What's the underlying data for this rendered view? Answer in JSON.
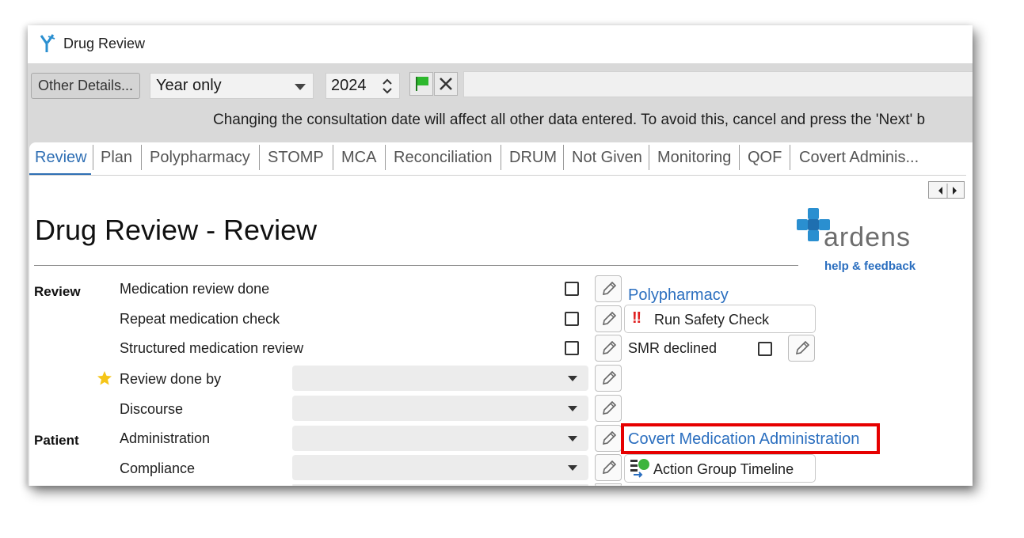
{
  "window": {
    "title": "Drug Review"
  },
  "toolbar": {
    "other_details_label": "Other Details...",
    "date_mode_value": "Year only",
    "year_value": "2024",
    "warning_text": "Changing the consultation date will affect all other data entered. To avoid this, cancel and press the 'Next' b"
  },
  "tabs": [
    {
      "label": "Review"
    },
    {
      "label": "Plan"
    },
    {
      "label": "Polypharmacy"
    },
    {
      "label": "STOMP"
    },
    {
      "label": "MCA"
    },
    {
      "label": "Reconciliation"
    },
    {
      "label": "DRUM"
    },
    {
      "label": "Not Given"
    },
    {
      "label": "Monitoring"
    },
    {
      "label": "QOF"
    },
    {
      "label": "Covert Adminis..."
    }
  ],
  "page": {
    "title": "Drug Review - Review"
  },
  "branding": {
    "name": "ardens",
    "help_link": "help & feedback",
    "brand_color": "#2a8fd0"
  },
  "sections": {
    "review": "Review",
    "patient": "Patient"
  },
  "rows": {
    "medication_review_done": "Medication review done",
    "repeat_medication_check": "Repeat medication check",
    "structured_medication_review": "Structured medication review",
    "review_done_by": "Review done by",
    "discourse": "Discourse",
    "administration": "Administration",
    "compliance": "Compliance"
  },
  "side": {
    "polypharmacy_link": "Polypharmacy",
    "run_safety_check": "Run Safety Check",
    "smr_declined": "SMR declined",
    "covert_medication_link": "Covert Medication Administration",
    "action_group_timeline": "Action Group Timeline"
  },
  "colors": {
    "link": "#2a6ebf",
    "highlight": "#e60000",
    "star": "#f5c518",
    "flag": "#2db82d",
    "alert": "#e02020"
  }
}
